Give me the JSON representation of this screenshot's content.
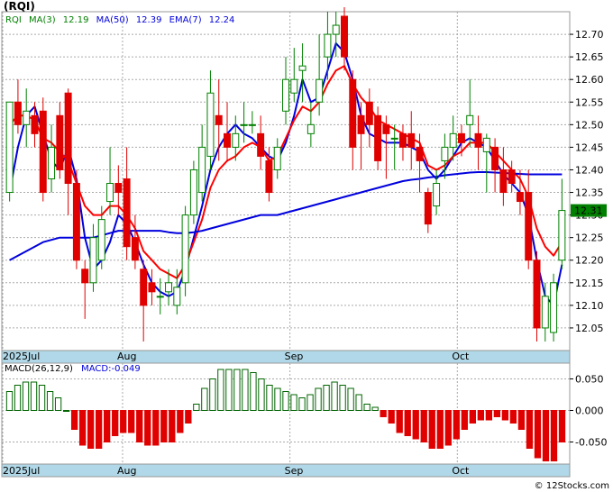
{
  "title": "(RQI)",
  "watermark": "© 12Stocks.com",
  "legend": {
    "symbol": "RQI",
    "ma3_label": "MA(3)",
    "ma3_value": "12.19",
    "ma50_label": "MA(50)",
    "ma50_value": "12.39",
    "ema7_label": "EMA(7)",
    "ema7_value": "12.24"
  },
  "macd_legend": {
    "label": "MACD(26,12,9)",
    "value": "MACD:-0.049"
  },
  "last_price_label": "12.31",
  "colors": {
    "up": "#008000",
    "down": "#e00000",
    "ma_blue": "#0000dd",
    "ma_red": "#ff0000",
    "axis_band": "#b0d8e8",
    "macd_pos": "#006400",
    "macd_neg": "#e00000",
    "badge": "#008000"
  },
  "chart_data": [
    {
      "type": "candlestick",
      "x_labels": [
        "2025Jul",
        "Aug",
        "Sep",
        "Oct"
      ],
      "price_axis": {
        "ticks": [
          "12.70",
          "12.65",
          "12.60",
          "12.55",
          "12.50",
          "12.45",
          "12.40",
          "12.35",
          "12.30",
          "12.25",
          "12.20",
          "12.15",
          "12.10",
          "12.05"
        ],
        "ylim": [
          12.0,
          12.75
        ]
      },
      "candles": [
        [
          12.35,
          12.55,
          12.55,
          12.33
        ],
        [
          12.55,
          12.5,
          12.6,
          12.48
        ],
        [
          12.5,
          12.53,
          12.58,
          12.45
        ],
        [
          12.52,
          12.48,
          12.55,
          12.45
        ],
        [
          12.53,
          12.35,
          12.56,
          12.33
        ],
        [
          12.38,
          12.45,
          12.5,
          12.35
        ],
        [
          12.52,
          12.4,
          12.55,
          12.38
        ],
        [
          12.57,
          12.37,
          12.58,
          12.3
        ],
        [
          12.37,
          12.2,
          12.4,
          12.18
        ],
        [
          12.18,
          12.15,
          12.2,
          12.07
        ],
        [
          12.15,
          12.25,
          12.28,
          12.13
        ],
        [
          12.2,
          12.29,
          12.32,
          12.18
        ],
        [
          12.33,
          12.37,
          12.45,
          12.3
        ],
        [
          12.37,
          12.35,
          12.41,
          12.3
        ],
        [
          12.38,
          12.23,
          12.45,
          12.2
        ],
        [
          12.25,
          12.2,
          12.3,
          12.18
        ],
        [
          12.18,
          12.1,
          12.2,
          12.02
        ],
        [
          12.15,
          12.13,
          12.18,
          12.1
        ],
        [
          12.12,
          12.12,
          12.16,
          12.08
        ],
        [
          12.13,
          12.15,
          12.18,
          12.1
        ],
        [
          12.1,
          12.14,
          12.18,
          12.08
        ],
        [
          12.15,
          12.3,
          12.32,
          12.12
        ],
        [
          12.3,
          12.4,
          12.42,
          12.28
        ],
        [
          12.35,
          12.45,
          12.5,
          12.33
        ],
        [
          12.43,
          12.57,
          12.62,
          12.4
        ],
        [
          12.52,
          12.5,
          12.6,
          12.42
        ],
        [
          12.48,
          12.45,
          12.55,
          12.42
        ],
        [
          12.45,
          12.48,
          12.52,
          12.42
        ],
        [
          12.5,
          12.5,
          12.55,
          12.46
        ],
        [
          12.5,
          12.5,
          12.53,
          12.48
        ],
        [
          12.48,
          12.43,
          12.52,
          12.4
        ],
        [
          12.42,
          12.35,
          12.45,
          12.33
        ],
        [
          12.4,
          12.45,
          12.47,
          12.38
        ],
        [
          12.53,
          12.6,
          12.65,
          12.5
        ],
        [
          12.57,
          12.6,
          12.67,
          12.55
        ],
        [
          12.62,
          12.63,
          12.68,
          12.55
        ],
        [
          12.48,
          12.5,
          12.55,
          12.45
        ],
        [
          12.55,
          12.6,
          12.7,
          12.52
        ],
        [
          12.65,
          12.7,
          12.75,
          12.6
        ],
        [
          12.7,
          12.72,
          12.75,
          12.65
        ],
        [
          12.74,
          12.65,
          12.76,
          12.62
        ],
        [
          12.6,
          12.45,
          12.62,
          12.4
        ],
        [
          12.52,
          12.48,
          12.55,
          12.4
        ],
        [
          12.55,
          12.5,
          12.58,
          12.45
        ],
        [
          12.52,
          12.42,
          12.54,
          12.4
        ],
        [
          12.5,
          12.48,
          12.52,
          12.38
        ],
        [
          12.47,
          12.47,
          12.5,
          12.4
        ],
        [
          12.48,
          12.45,
          12.5,
          12.42
        ],
        [
          12.48,
          12.45,
          12.53,
          12.4
        ],
        [
          12.45,
          12.42,
          12.48,
          12.35
        ],
        [
          12.35,
          12.28,
          12.36,
          12.26
        ],
        [
          12.32,
          12.37,
          12.4,
          12.3
        ],
        [
          12.42,
          12.45,
          12.48,
          12.38
        ],
        [
          12.45,
          12.48,
          12.52,
          12.42
        ],
        [
          12.48,
          12.46,
          12.5,
          12.43
        ],
        [
          12.5,
          12.52,
          12.6,
          12.45
        ],
        [
          12.48,
          12.45,
          12.52,
          12.4
        ],
        [
          12.44,
          12.47,
          12.48,
          12.35
        ],
        [
          12.45,
          12.4,
          12.47,
          12.35
        ],
        [
          12.4,
          12.35,
          12.45,
          12.32
        ],
        [
          12.4,
          12.37,
          12.42,
          12.35
        ],
        [
          12.35,
          12.33,
          12.4,
          12.3
        ],
        [
          12.35,
          12.2,
          12.4,
          12.18
        ],
        [
          12.2,
          12.05,
          12.22,
          12.02
        ],
        [
          12.05,
          12.12,
          12.15,
          12.02
        ],
        [
          12.04,
          12.15,
          12.17,
          12.02
        ],
        [
          12.2,
          12.31,
          12.38,
          12.18
        ]
      ],
      "series": [
        {
          "name": "MA(3)",
          "values": [
            12.35,
            12.45,
            12.52,
            12.54,
            12.48,
            12.42,
            12.4,
            12.45,
            12.38,
            12.25,
            12.18,
            12.2,
            12.24,
            12.3,
            12.28,
            12.24,
            12.19,
            12.15,
            12.13,
            12.12,
            12.13,
            12.18,
            12.25,
            12.32,
            12.4,
            12.45,
            12.48,
            12.5,
            12.48,
            12.47,
            12.45,
            12.43,
            12.42,
            12.46,
            12.52,
            12.6,
            12.55,
            12.56,
            12.62,
            12.68,
            12.66,
            12.6,
            12.52,
            12.48,
            12.47,
            12.46,
            12.46,
            12.46,
            12.45,
            12.44,
            12.4,
            12.38,
            12.4,
            12.43,
            12.46,
            12.47,
            12.46,
            12.45,
            12.42,
            12.39,
            12.37,
            12.35,
            12.3,
            12.2,
            12.12,
            12.1,
            12.19
          ]
        },
        {
          "name": "EMA(7)",
          "values": [
            12.5,
            12.52,
            12.52,
            12.51,
            12.47,
            12.46,
            12.44,
            12.42,
            12.37,
            12.32,
            12.3,
            12.3,
            12.32,
            12.32,
            12.3,
            12.27,
            12.22,
            12.2,
            12.18,
            12.17,
            12.16,
            12.19,
            12.24,
            12.29,
            12.36,
            12.4,
            12.42,
            12.43,
            12.45,
            12.46,
            12.45,
            12.42,
            12.43,
            12.47,
            12.51,
            12.54,
            12.53,
            12.55,
            12.59,
            12.62,
            12.63,
            12.59,
            12.56,
            12.54,
            12.51,
            12.5,
            12.49,
            12.48,
            12.47,
            12.46,
            12.41,
            12.4,
            12.41,
            12.43,
            12.44,
            12.46,
            12.46,
            12.46,
            12.44,
            12.42,
            12.4,
            12.38,
            12.34,
            12.27,
            12.23,
            12.21,
            12.24
          ]
        },
        {
          "name": "MA(50)",
          "values": [
            12.2,
            12.21,
            12.22,
            12.23,
            12.24,
            12.245,
            12.25,
            12.25,
            12.25,
            12.25,
            12.25,
            12.255,
            12.26,
            12.265,
            12.265,
            12.265,
            12.265,
            12.265,
            12.265,
            12.262,
            12.26,
            12.26,
            12.262,
            12.265,
            12.27,
            12.275,
            12.28,
            12.285,
            12.29,
            12.295,
            12.3,
            12.3,
            12.3,
            12.305,
            12.31,
            12.315,
            12.32,
            12.325,
            12.33,
            12.335,
            12.34,
            12.345,
            12.35,
            12.355,
            12.36,
            12.365,
            12.37,
            12.375,
            12.378,
            12.38,
            12.383,
            12.385,
            12.388,
            12.39,
            12.392,
            12.394,
            12.395,
            12.395,
            12.394,
            12.393,
            12.392,
            12.391,
            12.39,
            12.39,
            12.39,
            12.39,
            12.39
          ]
        }
      ]
    },
    {
      "type": "bar",
      "name": "MACD(26,12,9)",
      "y_ticks": [
        "0.050",
        "0.000",
        "-0.050"
      ],
      "ylim": [
        -0.085,
        0.075
      ],
      "values": [
        0.03,
        0.04,
        0.045,
        0.045,
        0.04,
        0.03,
        0.02,
        0.0,
        -0.03,
        -0.055,
        -0.06,
        -0.06,
        -0.05,
        -0.04,
        -0.035,
        -0.035,
        -0.05,
        -0.055,
        -0.055,
        -0.05,
        -0.05,
        -0.035,
        -0.02,
        0.01,
        0.035,
        0.05,
        0.065,
        0.065,
        0.065,
        0.065,
        0.06,
        0.05,
        0.04,
        0.035,
        0.03,
        0.025,
        0.02,
        0.025,
        0.035,
        0.04,
        0.045,
        0.04,
        0.035,
        0.025,
        0.01,
        0.005,
        -0.01,
        -0.02,
        -0.035,
        -0.04,
        -0.045,
        -0.05,
        -0.06,
        -0.06,
        -0.055,
        -0.045,
        -0.03,
        -0.02,
        -0.015,
        -0.015,
        -0.01,
        -0.015,
        -0.02,
        -0.03,
        -0.06,
        -0.075,
        -0.08,
        -0.08,
        -0.05
      ]
    }
  ]
}
